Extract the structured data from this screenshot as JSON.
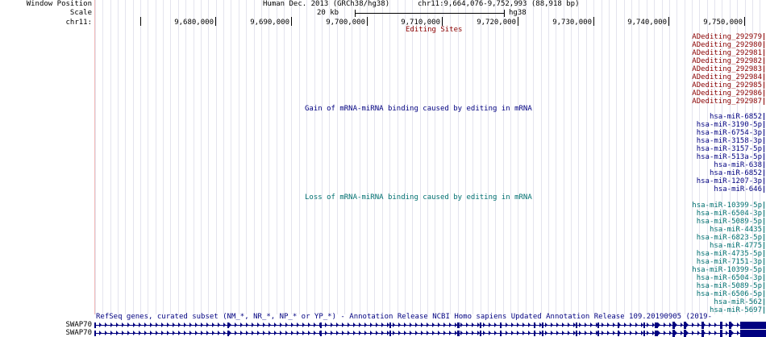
{
  "side_labels": {
    "window_position": "Window Position",
    "scale": "Scale",
    "chrom": "chr11:",
    "gene_rows": [
      "SWAP70",
      "SWAP70"
    ]
  },
  "header": {
    "assembly": "Human Dec. 2013 (GRCh38/hg38)",
    "position": "chr11:9,664,076-9,752,993 (88,918 bp)",
    "scale_label": "20 kb",
    "scale_db": "hg38"
  },
  "ruler": {
    "ticks": [
      "9,680,000",
      "9,690,000",
      "9,700,000",
      "9,710,000",
      "9,720,000",
      "9,730,000",
      "9,740,000",
      "9,750,000"
    ]
  },
  "tracks": {
    "editing_sites": {
      "title": "Editing Sites",
      "color": "#8b0000",
      "items": [
        "ADediting_292979",
        "ADediting_292980",
        "ADediting_292981",
        "ADediting_292982",
        "ADediting_292983",
        "ADediting_292984",
        "ADediting_292985",
        "ADediting_292986",
        "ADediting_292987"
      ]
    },
    "gain": {
      "title": "Gain of mRNA-miRNA binding caused by editing in mRNA",
      "color": "#000080",
      "items": [
        "hsa-miR-6852",
        "hsa-miR-3190-5p",
        "hsa-miR-6754-3p",
        "hsa-miR-3158-3p",
        "hsa-miR-3157-5p",
        "hsa-miR-513a-5p",
        "hsa-miR-638",
        "hsa-miR-6852",
        "hsa-miR-1207-3p",
        "hsa-miR-646"
      ]
    },
    "loss": {
      "title": "Loss of mRNA-miRNA binding caused by editing in mRNA",
      "color": "#007070",
      "items": [
        "hsa-miR-10399-5p",
        "hsa-miR-6504-3p",
        "hsa-miR-5089-5p",
        "hsa-miR-4435",
        "hsa-miR-6823-5p",
        "hsa-miR-4775",
        "hsa-miR-4735-5p",
        "hsa-miR-7151-3p",
        "hsa-miR-10399-5p",
        "hsa-miR-6504-3p",
        "hsa-miR-5089-5p",
        "hsa-miR-6506-5p",
        "hsa-miR-562",
        "hsa-miR-5697"
      ]
    },
    "refseq": {
      "title": "RefSeq genes, curated subset (NM_*, NR_*, NP_* or YP_*) - Annotation Release NCBI Homo sapiens Updated Annotation Release 109.20190905 (2019-",
      "color": "#000080"
    }
  }
}
